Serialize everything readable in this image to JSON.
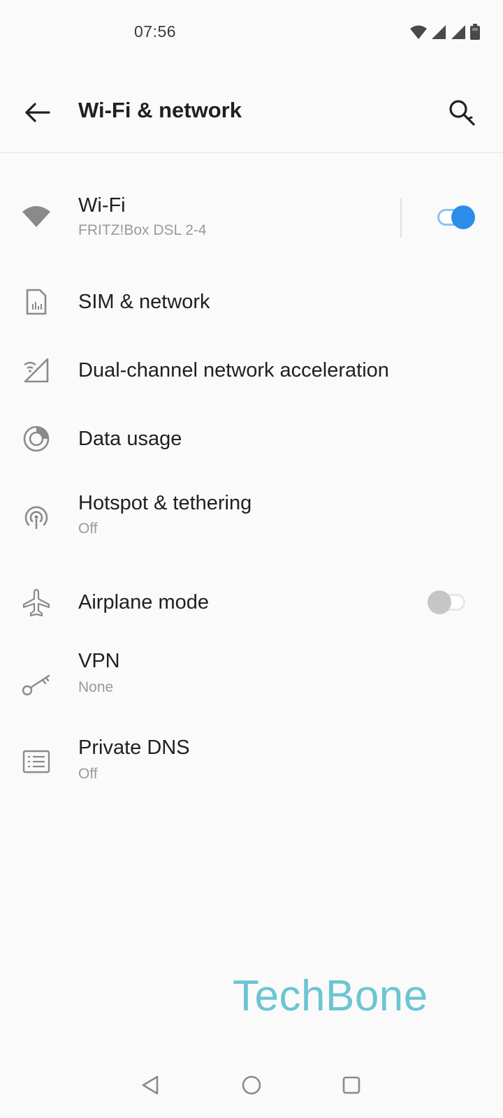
{
  "status_bar": {
    "time": "07:56",
    "icons": [
      "wifi-signal-icon",
      "cell-signal-icon",
      "cell-signal-icon",
      "battery-icon"
    ]
  },
  "app_bar": {
    "title": "Wi-Fi & network",
    "back_icon": "arrow-left-icon",
    "search_icon": "search-icon"
  },
  "settings": {
    "wifi": {
      "title": "Wi-Fi",
      "subtitle": "FRITZ!Box DSL 2-4",
      "toggle": "on",
      "icon": "wifi-icon"
    },
    "sim": {
      "title": "SIM & network",
      "icon": "sim-card-icon"
    },
    "dual_channel": {
      "title": "Dual-channel network acceleration",
      "icon": "dual-channel-icon"
    },
    "data_usage": {
      "title": "Data usage",
      "icon": "data-usage-icon"
    },
    "hotspot": {
      "title": "Hotspot & tethering",
      "subtitle": "Off",
      "icon": "hotspot-icon"
    },
    "airplane": {
      "title": "Airplane mode",
      "toggle": "off",
      "icon": "airplane-icon"
    },
    "vpn": {
      "title": "VPN",
      "subtitle": "None",
      "icon": "key-icon"
    },
    "private_dns": {
      "title": "Private DNS",
      "subtitle": "Off",
      "icon": "dns-icon"
    }
  },
  "watermark": "TechBone",
  "nav_bar": {
    "buttons": [
      "back-triangle-icon",
      "home-circle-icon",
      "recents-square-icon"
    ]
  },
  "colors": {
    "accent": "#2b8cea",
    "watermark": "#6bc5d2",
    "text_primary": "#202020",
    "text_secondary": "#9a9a9a",
    "background": "#fafafa"
  }
}
